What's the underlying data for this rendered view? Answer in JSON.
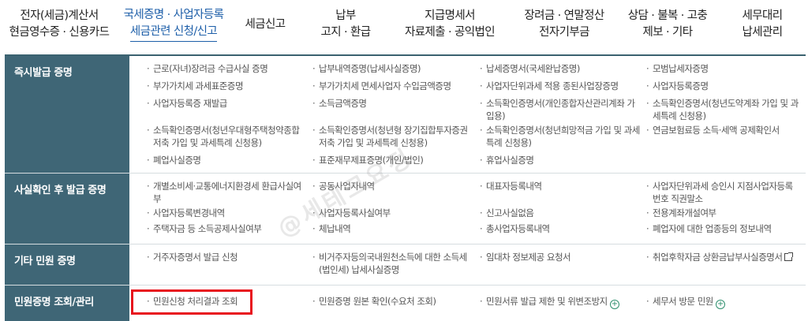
{
  "nav": [
    {
      "line1": "전자(세금)계산서",
      "line2": "현금영수증 · 신용카드"
    },
    {
      "line1": "국세증명 · 사업자등록",
      "line2": "세금관련 신청/신고"
    },
    {
      "line1": "세금신고",
      "line2": ""
    },
    {
      "line1": "납부",
      "line2": "고지 · 환급"
    },
    {
      "line1": "지급명세서",
      "line2": "자료제출 · 공익법인"
    },
    {
      "line1": "장려금 · 연말정산",
      "line2": "전자기부금"
    },
    {
      "line1": "상담 · 불복 · 고충",
      "line2": "제보 · 기타"
    },
    {
      "line1": "세무대리",
      "line2": "납세관리"
    }
  ],
  "rows": [
    {
      "head": "즉시발급 증명",
      "items": [
        "근로(자녀)장려금 수급사실 증명",
        "납부내역증명(납세사실증명)",
        "납세증명서(국세완납증명)",
        "모범납세자증명",
        "부가가치세 과세표준증명",
        "부가가치세 면세사업자 수입금액증명",
        "사업자단위과세 적용 종된사업장증명",
        "사업자등록증명",
        "사업자등록증 재발급",
        "소득금액증명",
        "소득확인증명서(개인종합자산관리계좌 가입용)",
        "소득확인증명서(청년도약계좌 가입 및 과세특례 신청용)",
        "소득확인증명서(청년우대형주택청약종합저축 가입 및 과세특례 신청용)",
        "소득확인증명서(청년형 장기집합투자증권저축 가입 및 과세특례 신청용)",
        "소득확인증명서(청년희망적금 가입 및 과세특례 신청용)",
        "연금보험료등 소득·세액 공제확인서",
        "폐업사실증명",
        "표준재무제표증명(개인/법인)",
        "휴업사실증명"
      ]
    },
    {
      "head": "사실확인 후 발급 증명",
      "items": [
        "개별소비세·교통에너지환경세 환급사실여부",
        "공동사업자내역",
        "대표자등록내역",
        "사업자단위과세 승인시 지점사업자등록번호 직권말소",
        "사업자등록변경내역",
        "사업자등록사실여부",
        "신고사실없음",
        "전용계좌개설여부",
        "주택자금 등 소득공제사실여부",
        "체납내역",
        "총사업자등록내역",
        "폐업자에 대한 업종등의 정보내역"
      ]
    },
    {
      "head": "기타 민원 증명",
      "items": [
        "거주자증명서 발급 신청",
        "비거주자등의국내원천소득에 대한 소득세(법인세) 납세사실증명",
        "임대차 정보제공 요청서",
        "취업후학자금 상환금납부사실증명서"
      ]
    },
    {
      "head": "민원증명 조회/관리",
      "items": [
        "민원신청 처리결과 조회",
        "민원증명 원본 확인(수요처 조회)",
        "민원서류 발급 제한 및 위변조방지",
        "세무서 방문 민원"
      ]
    }
  ],
  "watermark": "@세테크요정"
}
